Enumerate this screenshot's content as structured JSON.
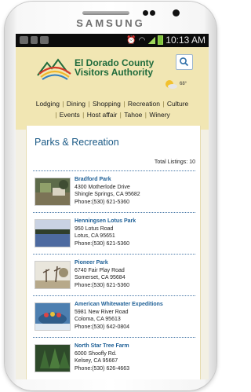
{
  "device": {
    "brand": "SAMSUNG"
  },
  "status_bar": {
    "time": "10:13 AM"
  },
  "site": {
    "name_line1": "El Dorado County",
    "name_line2": "Visitors Authority",
    "weather_temp": "68°"
  },
  "nav": {
    "row1": [
      "Lodging",
      "Dining",
      "Shopping",
      "Recreation",
      "Culture"
    ],
    "row2": [
      "Events",
      "Host affair",
      "Tahoe",
      "Winery"
    ]
  },
  "page": {
    "title": "Parks & Recreation",
    "total_listings": "Total Listings: 10"
  },
  "listings": [
    {
      "name": "Bradford Park",
      "address": "4300 Motherlode Drive",
      "city": "Shingle Springs, CA 95682",
      "phone": "Phone:(530) 621-5360"
    },
    {
      "name": "Henningsen Lotus Park",
      "address": "950 Lotus Road",
      "city": "Lotus, CA 95651",
      "phone": "Phone:(530) 621-5360"
    },
    {
      "name": "Pioneer Park",
      "address": "6740 Fair Play Road",
      "city": "Somerset, CA 95684",
      "phone": "Phone:(530) 621-5360"
    },
    {
      "name": "American Whitewater Expeditions",
      "address": "5981 New River Road",
      "city": "Coloma, CA 95613",
      "phone": "Phone:(530) 642-0804"
    },
    {
      "name": "North Star Tree Farm",
      "address": "6000 Shoofly Rd.",
      "city": "Kelsey, CA 95667",
      "phone": "Phone:(530) 626-4663"
    }
  ]
}
